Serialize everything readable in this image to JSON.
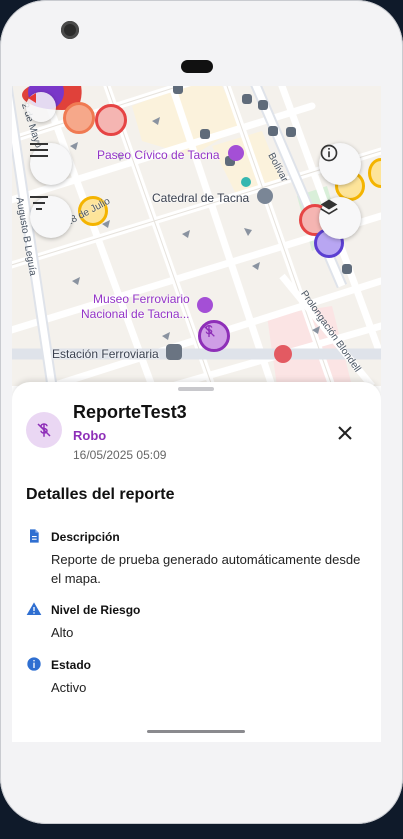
{
  "map": {
    "poi": {
      "paseo": "Paseo Cívico de Tacna",
      "catedral": "Catedral de Tacna",
      "museo_line1": "Museo Ferroviario",
      "museo_line2": "Nacional de Tacna...",
      "estacion": "Estación Ferroviaria"
    },
    "streets": {
      "bolivar": "Bolívar",
      "augusto": "Augusto B Leguía",
      "dos_de_mayo": "2 de Mayo",
      "veintiocho": "Prol. 28 de Julio",
      "prolongacion": "Prolongación Blondell"
    },
    "controls": {
      "menu_icon": "menu-icon",
      "filter_icon": "filter-icon",
      "info_icon": "info-icon",
      "layers_icon": "layers-icon"
    }
  },
  "report": {
    "title": "ReporteTest3",
    "category": "Robo",
    "datetime": "16/05/2025 05:09"
  },
  "details": {
    "section_title": "Detalles del reporte",
    "description_label": "Descripción",
    "description_value": "Reporte de prueba generado automáticamente desde el mapa.",
    "risk_label": "Nivel de Riesgo",
    "risk_value": "Alto",
    "status_label": "Estado",
    "status_value": "Activo"
  },
  "colors": {
    "accent": "#8e2fb8",
    "risk_icon": "#2f6fd1",
    "marker_red": "#e53935",
    "marker_yellow": "#f4b400"
  }
}
